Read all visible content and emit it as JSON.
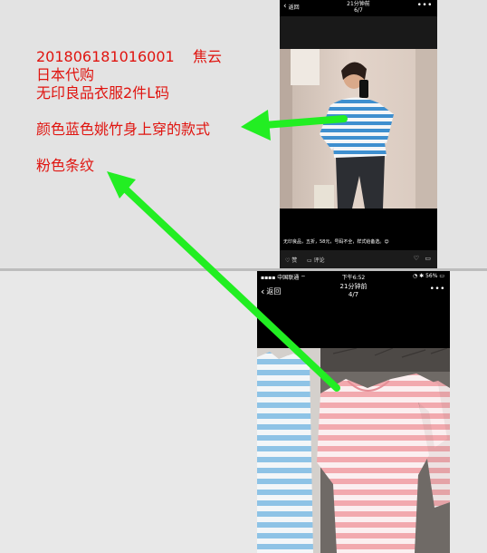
{
  "annotations": {
    "line1": "201806181016001    焦云",
    "line2": "日本代购",
    "line3": "无印良品衣服2件L码",
    "line4": "颜色蓝色姚竹身上穿的款式",
    "line5": "粉色条纹"
  },
  "phone_top": {
    "back_label": "返回",
    "time_ago": "21分钟前",
    "page": "6/7",
    "caption": "无印良品，五折，58元，号码不全，样式给备选。😊",
    "like_label": "赞",
    "comment_label": "评论"
  },
  "phone_bottom": {
    "carrier": "中国联通",
    "clock": "下午6:52",
    "battery": "56%",
    "back_label": "返回",
    "time_ago": "21分钟前",
    "page": "4/7"
  },
  "colors": {
    "annotation_text": "#e0140f",
    "arrow": "#22ee22",
    "blue_stripe": "#8ec3e6",
    "pink_stripe": "#f2a9ae"
  }
}
